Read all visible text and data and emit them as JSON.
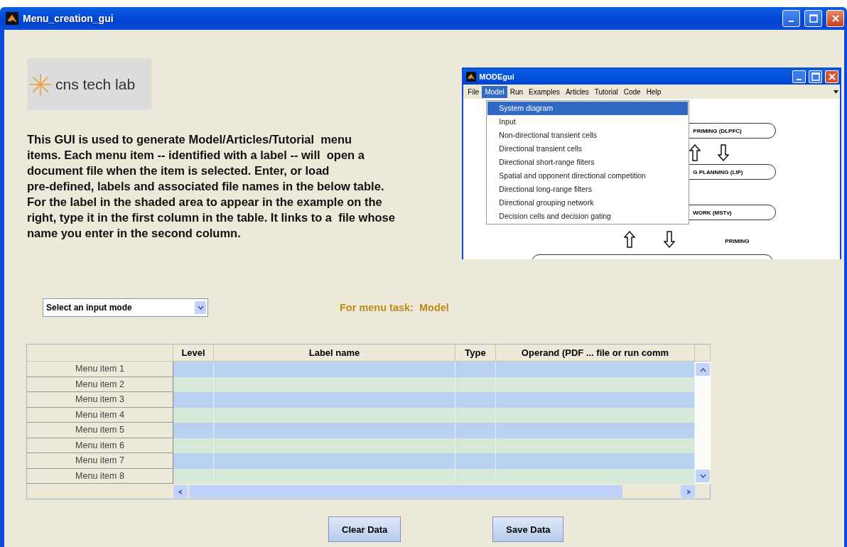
{
  "window": {
    "title": "Menu_creation_gui"
  },
  "logo": {
    "text": "cns tech lab"
  },
  "description": "This GUI is used to generate Model/Articles/Tutorial  menu\nitems. Each menu item -- identified with a label -- will  open a\ndocument file when the item is selected. Enter, or load\npre-defined, labels and associated file names in the below table.\nFor the label in the shaded area to appear in the example on the\nright, type it in the first column in the table. It links to a  file whose\nname you enter in the second column.",
  "example_window": {
    "title": "MODEgui",
    "menu": [
      {
        "label": "File",
        "selected": false
      },
      {
        "label": "Model",
        "selected": true
      },
      {
        "label": "Run",
        "selected": false
      },
      {
        "label": "Examples",
        "selected": false
      },
      {
        "label": "Articles",
        "selected": false
      },
      {
        "label": "Tutorial",
        "selected": false
      },
      {
        "label": "Code",
        "selected": false
      },
      {
        "label": "Help",
        "selected": false
      }
    ],
    "dropdown": [
      {
        "label": "System diagram",
        "selected": true
      },
      {
        "label": "Input",
        "selected": false
      },
      {
        "label": "Non-directional transient cells",
        "selected": false
      },
      {
        "label": "Directional transient cells",
        "selected": false
      },
      {
        "label": "Directional short-range filters",
        "selected": false
      },
      {
        "label": "Spatial and opponent directional competition",
        "selected": false
      },
      {
        "label": "Directional long-range filters",
        "selected": false
      },
      {
        "label": "Directional grouping network",
        "selected": false
      },
      {
        "label": "Decision cells and decision gating",
        "selected": false
      }
    ],
    "diagram_labels": [
      "PRIMING (DLPFC)",
      "G PLANNING (LIP)",
      "WORK (MSTv)",
      "PRIMING"
    ]
  },
  "input_mode": {
    "value": "Select an input mode"
  },
  "menu_task": {
    "label": "For menu task:",
    "value": "Model"
  },
  "table": {
    "columns": [
      "Level",
      "Label name",
      "Type",
      "Operand (PDF ... file or run comm"
    ],
    "rows": [
      "Menu item 1",
      "Menu item 2",
      "Menu item 3",
      "Menu item 4",
      "Menu item 5",
      "Menu item 6",
      "Menu item 7",
      "Menu item 8"
    ]
  },
  "buttons": [
    "Clear Data",
    "Save Data"
  ]
}
